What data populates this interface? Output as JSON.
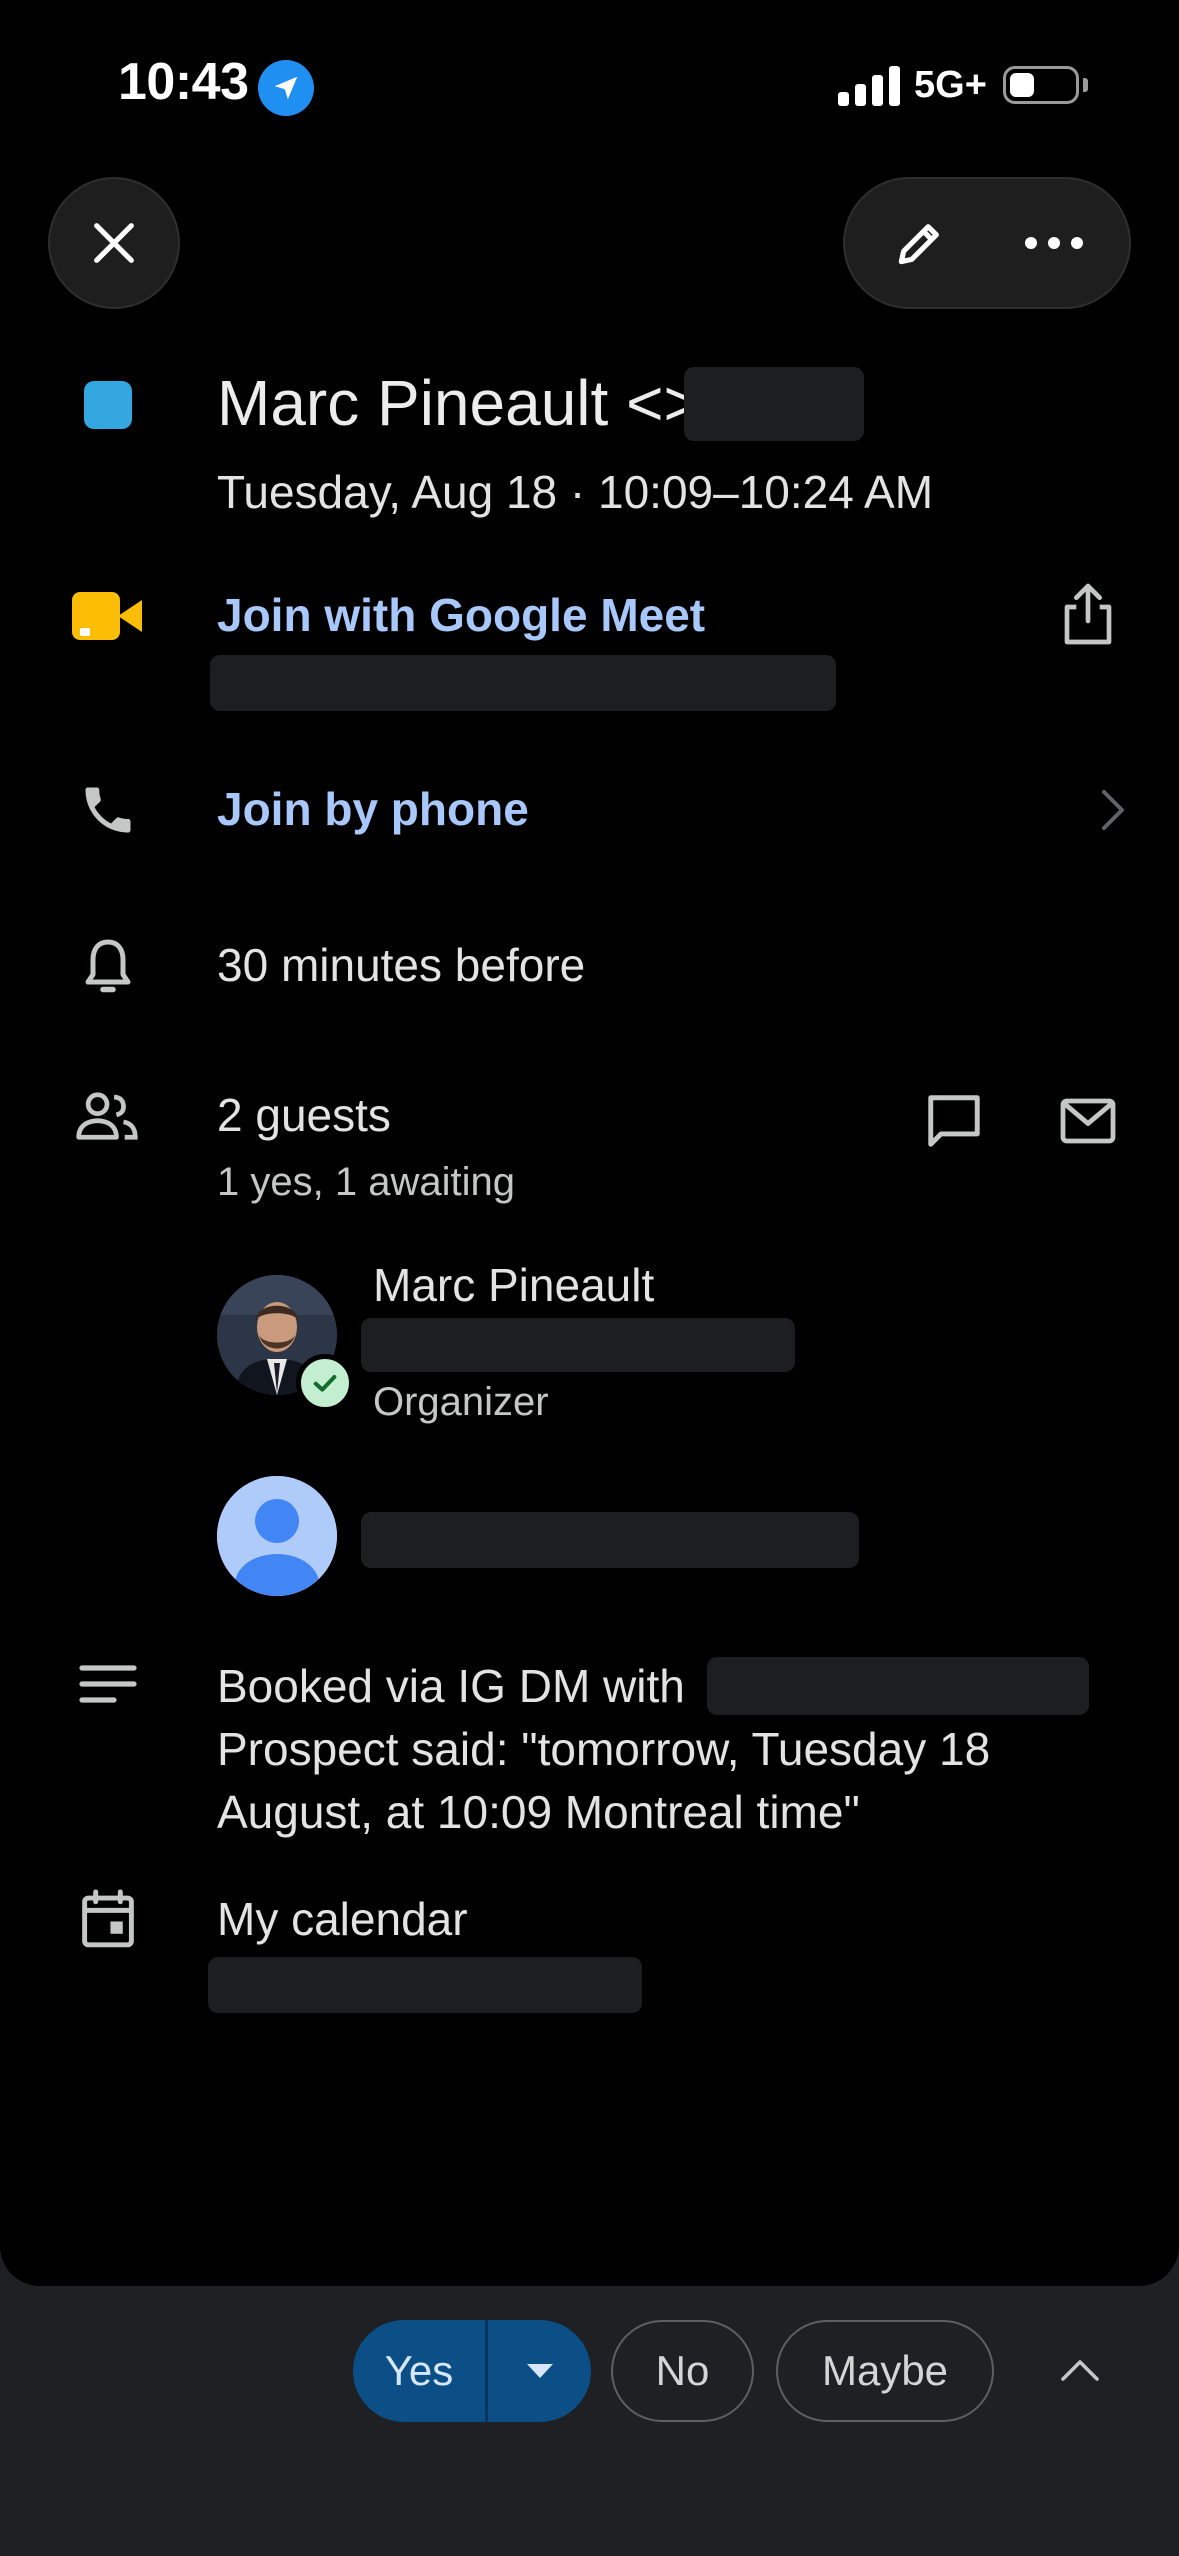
{
  "status_bar": {
    "time": "10:43",
    "network": "5G+"
  },
  "event": {
    "title": "Marc Pineault <>",
    "datetime": "Tuesday, Aug 18 · 10:09–10:24 AM",
    "color": "#34a6e0"
  },
  "meet": {
    "label": "Join with Google Meet"
  },
  "phone": {
    "label": "Join by phone"
  },
  "reminder": {
    "text": "30 minutes before"
  },
  "guests": {
    "count_label": "2 guests",
    "summary": "1 yes, 1 awaiting",
    "list": [
      {
        "name": "Marc Pineault",
        "role": "Organizer"
      }
    ]
  },
  "description": {
    "line1": "Booked via IG DM with",
    "line2": "Prospect said: \"tomorrow, Tuesday 18",
    "line3": "August, at 10:09 Montreal time\""
  },
  "calendar": {
    "name": "My calendar"
  },
  "rsvp": {
    "yes": "Yes",
    "no": "No",
    "maybe": "Maybe"
  },
  "colors": {
    "accent": "#a8c7fa",
    "yes_bg": "#0b4f86"
  }
}
